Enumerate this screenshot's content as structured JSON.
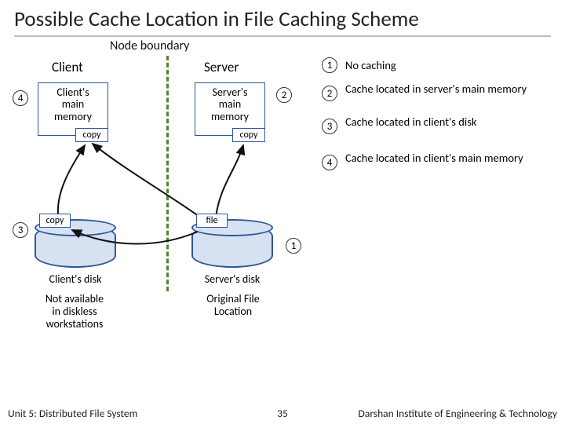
{
  "title": "Possible Cache Location in File Caching Scheme",
  "labels": {
    "node_boundary": "Node boundary",
    "client": "Client",
    "server": "Server",
    "client_mem": "Client's\nmain\nmemory",
    "server_mem": "Server's\nmain\nmemory",
    "copy": "copy",
    "file": "file",
    "client_disk": "Client's disk",
    "server_disk": "Server's disk",
    "not_available": "Not available\nin diskless\nworkstations",
    "original": "Original File\nLocation"
  },
  "side_numbers": {
    "left_top": "4",
    "mid_right": "2",
    "left_mid": "3",
    "disk_right": "1"
  },
  "legend": [
    {
      "n": "1",
      "t": "No caching"
    },
    {
      "n": "2",
      "t": "Cache located in server's main memory"
    },
    {
      "n": "3",
      "t": "Cache located in client's disk"
    },
    {
      "n": "4",
      "t": "Cache located in client's main memory"
    }
  ],
  "footer": {
    "left": "Unit 5: Distributed File System",
    "page": "35",
    "right": "Darshan Institute of Engineering & Technology"
  }
}
